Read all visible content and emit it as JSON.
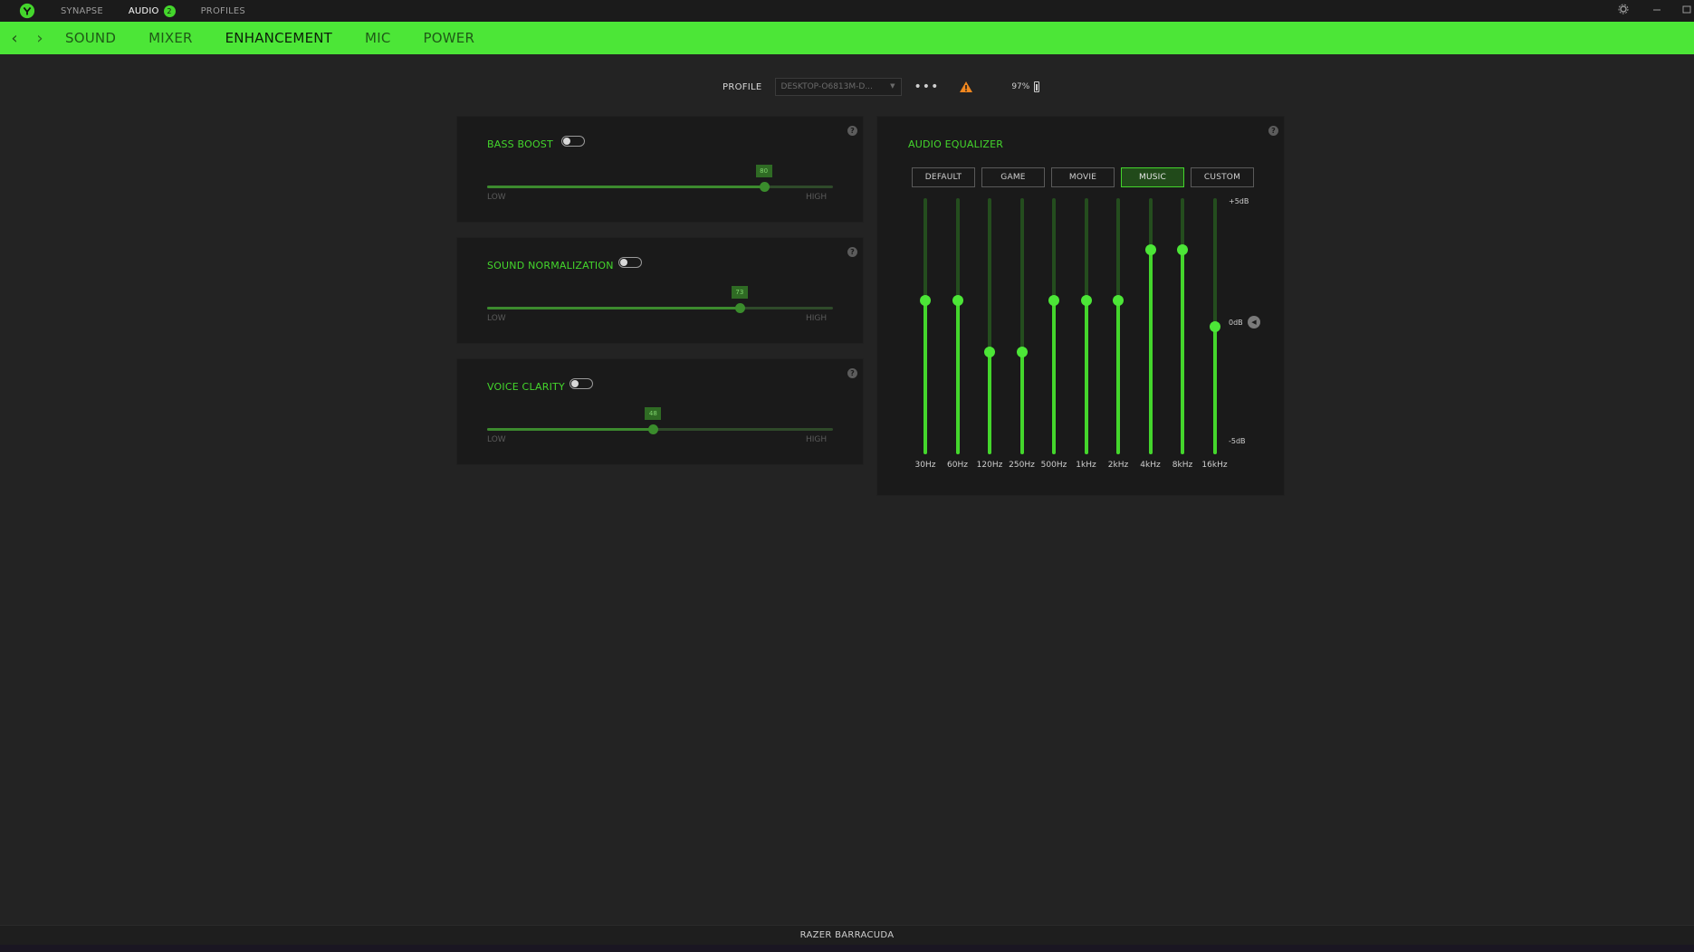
{
  "topbar": {
    "tabs": [
      {
        "label": "SYNAPSE",
        "active": false
      },
      {
        "label": "AUDIO",
        "active": true,
        "badge": "2"
      },
      {
        "label": "PROFILES",
        "active": false
      }
    ],
    "settings_icon": "gear-icon",
    "minimize_icon": "minimize-icon",
    "maximize_icon": "maximize-icon"
  },
  "nav": {
    "back_icon": "chevron-left-icon",
    "forward_icon": "chevron-right-icon",
    "tabs": [
      {
        "label": "SOUND",
        "active": false
      },
      {
        "label": "MIXER",
        "active": false
      },
      {
        "label": "ENHANCEMENT",
        "active": true
      },
      {
        "label": "MIC",
        "active": false
      },
      {
        "label": "POWER",
        "active": false
      }
    ]
  },
  "profile": {
    "label": "PROFILE",
    "selected": "DESKTOP-O6813M-D...",
    "more_label": "•••",
    "battery": "97%"
  },
  "enhancements": [
    {
      "title": "BASS BOOST",
      "value": "80",
      "percent": 80,
      "low": "LOW",
      "high": "HIGH",
      "enabled": false
    },
    {
      "title": "SOUND NORMALIZATION",
      "value": "73",
      "percent": 73,
      "low": "LOW",
      "high": "HIGH",
      "enabled": false
    },
    {
      "title": "VOICE CLARITY",
      "value": "48",
      "percent": 48,
      "low": "LOW",
      "high": "HIGH",
      "enabled": false
    }
  ],
  "equalizer": {
    "title": "AUDIO EQUALIZER",
    "presets": [
      {
        "label": "DEFAULT",
        "active": false
      },
      {
        "label": "GAME",
        "active": false
      },
      {
        "label": "MOVIE",
        "active": false
      },
      {
        "label": "MUSIC",
        "active": true
      },
      {
        "label": "CUSTOM",
        "active": false
      }
    ],
    "scale_top": "+5dB",
    "scale_mid": "0dB",
    "scale_bottom": "-5dB",
    "db_range": [
      -5,
      5
    ],
    "bands": [
      {
        "freq": "30Hz",
        "db": 1
      },
      {
        "freq": "60Hz",
        "db": 1
      },
      {
        "freq": "120Hz",
        "db": -1
      },
      {
        "freq": "250Hz",
        "db": -1
      },
      {
        "freq": "500Hz",
        "db": 1
      },
      {
        "freq": "1kHz",
        "db": 1
      },
      {
        "freq": "2kHz",
        "db": 1
      },
      {
        "freq": "4kHz",
        "db": 3
      },
      {
        "freq": "8kHz",
        "db": 3
      },
      {
        "freq": "16kHz",
        "db": 0
      }
    ]
  },
  "footer": {
    "device": "RAZER BARRACUDA"
  },
  "colors": {
    "accent": "#44d62c",
    "background": "#232323",
    "panel": "#1a1a1a"
  }
}
